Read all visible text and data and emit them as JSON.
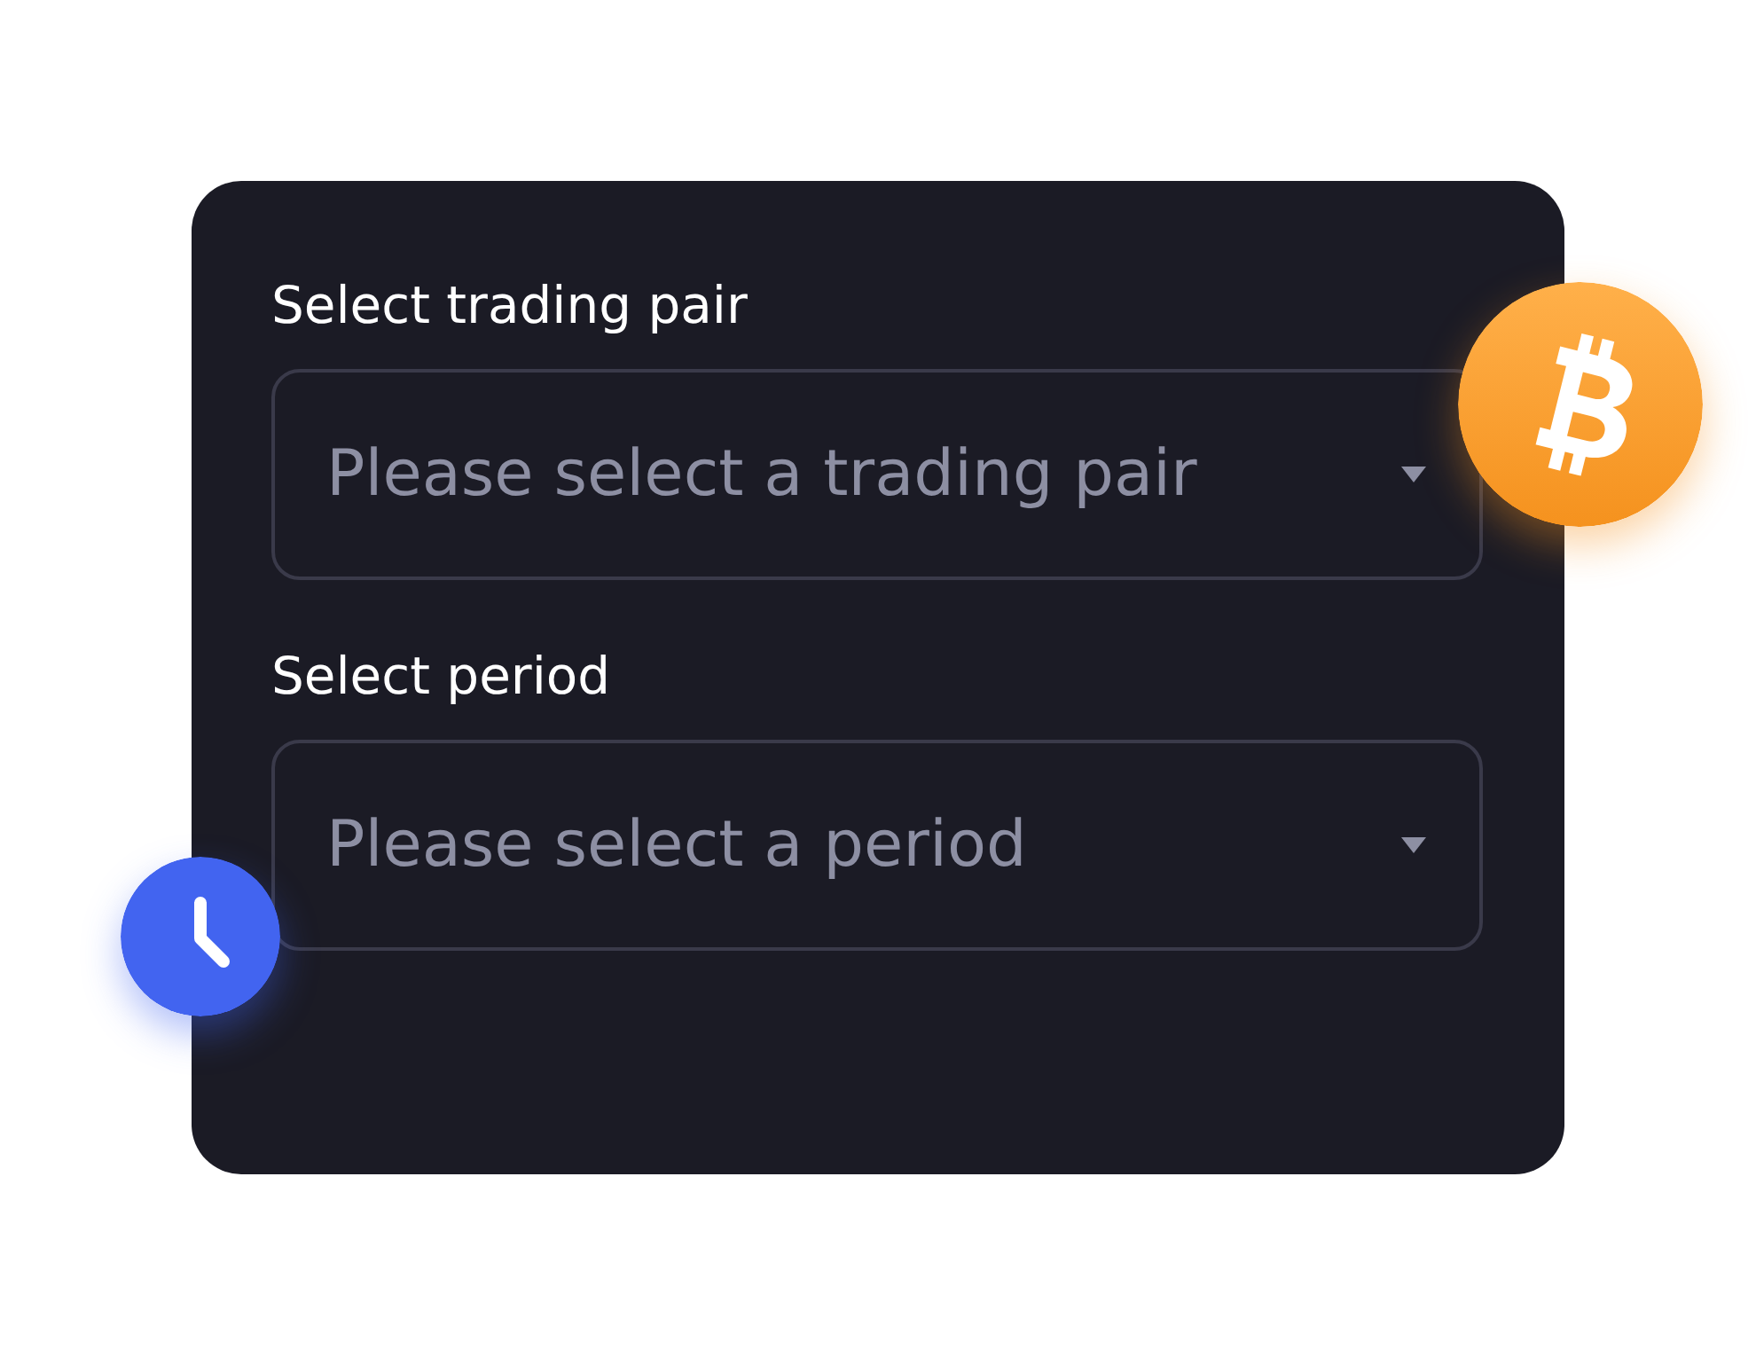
{
  "form": {
    "fields": [
      {
        "label": "Select trading pair",
        "placeholder": "Please select a trading pair"
      },
      {
        "label": "Select period",
        "placeholder": "Please select a period"
      }
    ]
  }
}
